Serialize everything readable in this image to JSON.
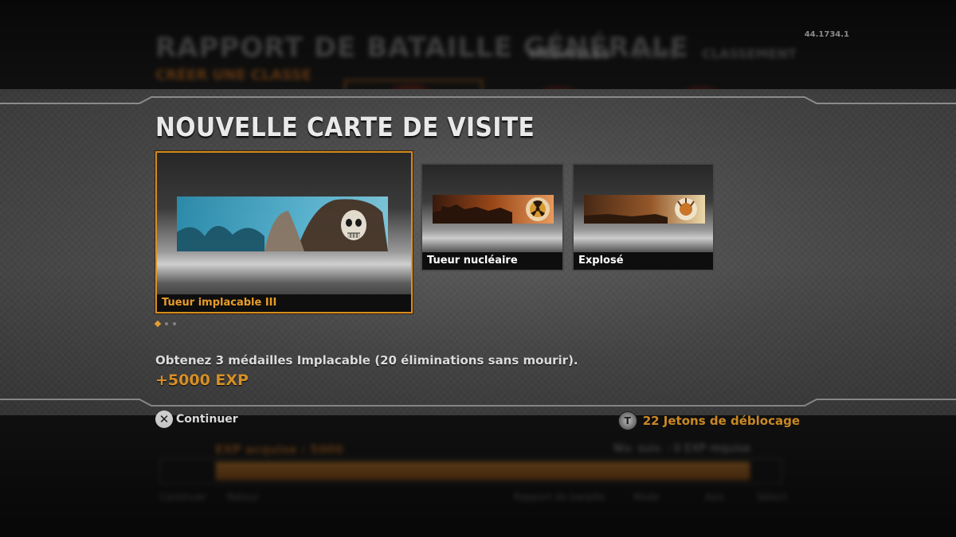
{
  "version_label": "44.1734.1",
  "background": {
    "title": "RAPPORT DE BATAILLE GÉNÉRALE",
    "subtitle": "CRÉER UNE CLASSE",
    "tabs": [
      "MÉDAILLES",
      "STATS",
      "CLASSEMENT"
    ],
    "xp_label": "EXP acquise : 5000",
    "xp_next": "Niv. suiv. : 0 EXP requise",
    "footer_left": [
      "Continuer",
      "Retour"
    ],
    "footer_right": [
      "Rapport de bataille",
      "Mode",
      "Avis",
      "Sélect."
    ]
  },
  "popup": {
    "title": "NOUVELLE CARTE DE VISITE",
    "cards": [
      {
        "label": "Tueur implacable III",
        "selected": true,
        "art": "reaper-calling-card"
      },
      {
        "label": "Tueur nucléaire",
        "selected": false,
        "art": "nuclear-calling-card"
      },
      {
        "label": "Explosé",
        "selected": false,
        "art": "explosion-calling-card"
      }
    ],
    "pagination": {
      "count": 3,
      "active": 1
    },
    "description": "Obtenez 3 médailles Implacable (20 éliminations sans mourir).",
    "reward": "+5000 EXP",
    "continue_label": "Continuer",
    "continue_button_glyph": "✕",
    "tokens_label": "22 Jetons de déblocage",
    "tokens_icon_glyph": "T"
  },
  "colors": {
    "accent": "#f0a12a",
    "selected_border": "#e0941f",
    "text": "#ffffff"
  }
}
